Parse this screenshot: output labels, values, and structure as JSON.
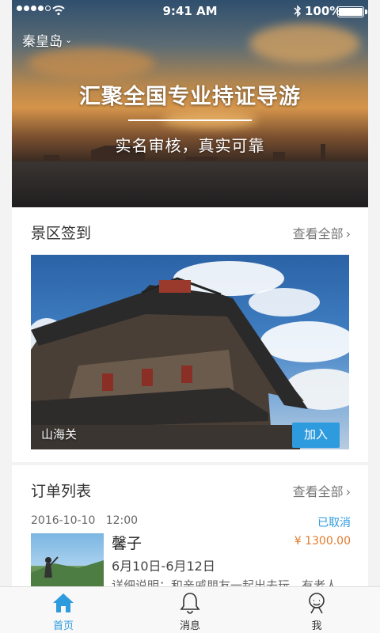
{
  "status_bar": {
    "time": "9:41 AM",
    "battery": "100%",
    "battery_level": 1.0
  },
  "hero": {
    "city": "秦皇岛",
    "title": "汇聚全国专业持证导游",
    "subtitle": "实名审核，真实可靠"
  },
  "scenic_section": {
    "title": "景区签到",
    "more": "查看全部",
    "spot_name": "山海关",
    "join_label": "加入"
  },
  "order_section": {
    "title": "订单列表",
    "more": "查看全部",
    "order": {
      "date": "2016-10-10",
      "time": "12:00",
      "status": "已取消",
      "guide_name": "馨子",
      "price": "¥ 1300.00",
      "date_range": "6月10日-6月12日",
      "detail": "详细说明：和亲戚朋友一起出去玩，有老人"
    }
  },
  "tabbar": {
    "items": [
      {
        "label": "首页",
        "icon": "home-icon",
        "active": true
      },
      {
        "label": "消息",
        "icon": "bell-icon",
        "active": false
      },
      {
        "label": "我",
        "icon": "user-icon",
        "active": false
      }
    ]
  },
  "colors": {
    "accent": "#2e9bde",
    "price": "#e07a2e"
  }
}
